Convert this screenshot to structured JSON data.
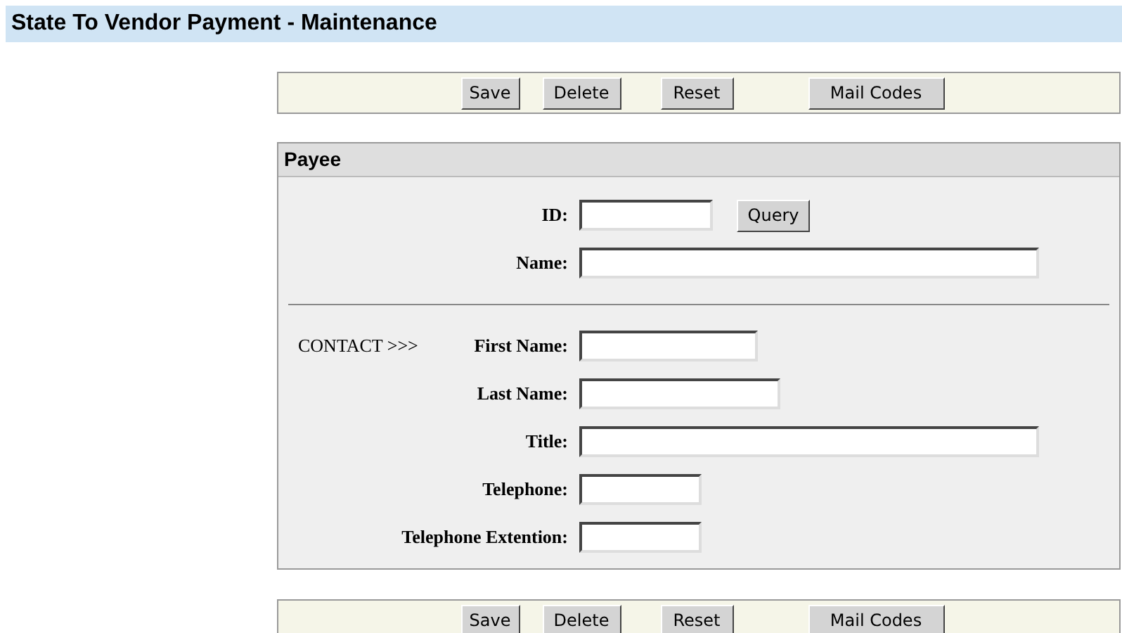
{
  "title": "State To Vendor Payment - Maintenance",
  "toolbar_top": [
    "Save",
    "Delete",
    "Reset",
    "Mail Codes"
  ],
  "panel": {
    "title": "Payee",
    "fields": [
      {
        "label": "ID:",
        "button": "Query"
      },
      {
        "label": "Name:"
      }
    ],
    "contact": {
      "label": "CONTACT >>>",
      "fields": [
        {
          "label": "First Name:"
        },
        {
          "label": "Last Name:"
        },
        {
          "label": "Title:"
        },
        {
          "label": "Telephone:"
        },
        {
          "label": "Telephone Extention:"
        }
      ]
    }
  },
  "toolbar_bottom": [
    "Save",
    "Delete",
    "Reset",
    "Mail Codes"
  ]
}
